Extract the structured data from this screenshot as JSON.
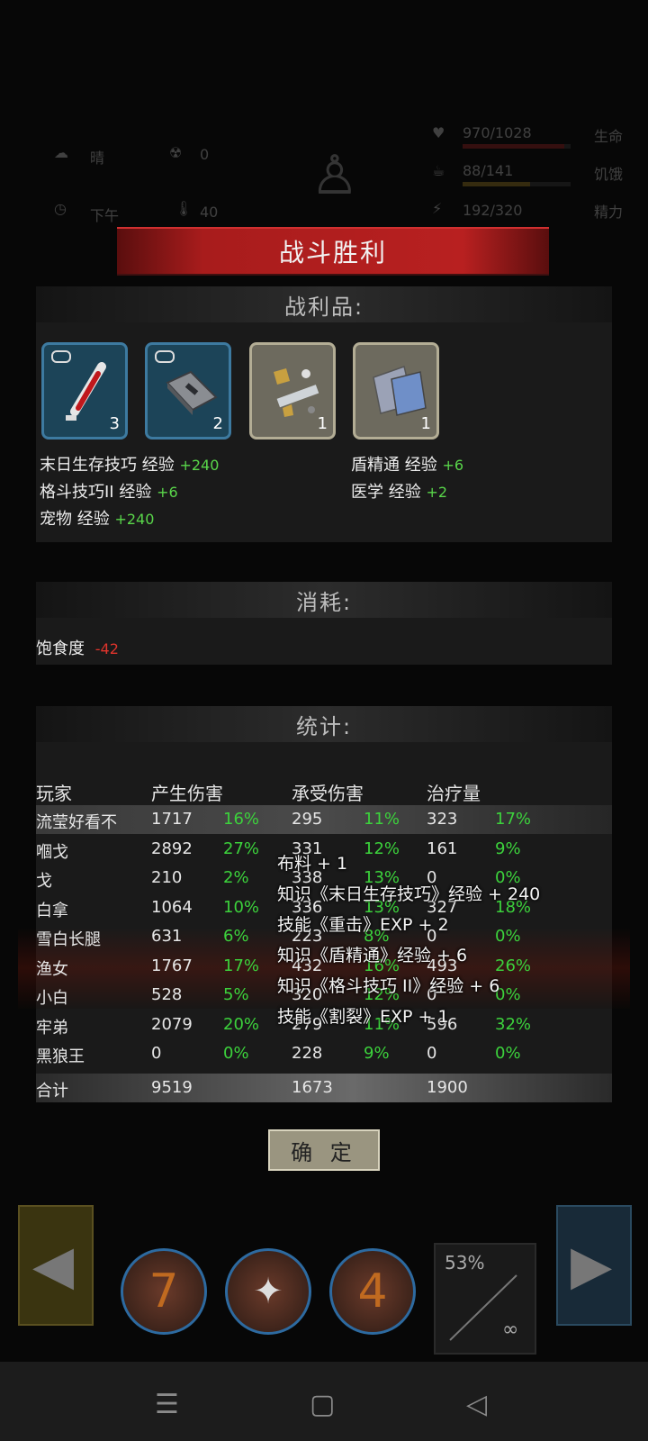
{
  "hud": {
    "weather": "晴",
    "radiation": "0",
    "time": "下午",
    "temperature": "40",
    "hp": "970/1028",
    "hp_label": "生命",
    "hunger": "88/141",
    "hunger_label": "饥饿",
    "energy": "192/320",
    "energy_label": "精力"
  },
  "title": "战斗胜利",
  "loot": {
    "heading": "战利品:",
    "items": [
      {
        "name": "syringe-icon",
        "count": "3"
      },
      {
        "name": "metal-plate-icon",
        "count": "2"
      },
      {
        "name": "scrap-parts-icon",
        "count": "1"
      },
      {
        "name": "cloth-icon",
        "count": "1"
      }
    ],
    "exp_left": [
      {
        "label": "末日生存技巧 经验",
        "gain": "+240"
      },
      {
        "label": "格斗技巧II 经验",
        "gain": "+6"
      },
      {
        "label": "宠物 经验",
        "gain": "+240"
      }
    ],
    "exp_right": [
      {
        "label": "盾精通 经验",
        "gain": "+6"
      },
      {
        "label": "医学 经验",
        "gain": "+2"
      }
    ]
  },
  "consume": {
    "heading": "消耗:",
    "label": "饱食度",
    "value": "-42"
  },
  "stats": {
    "heading": "统计:",
    "headers": [
      "玩家",
      "产生伤害",
      "承受伤害",
      "治疗量"
    ],
    "rows": [
      {
        "player": "流莹好看不",
        "dealt": "1717",
        "dealt_pct": "16%",
        "taken": "295",
        "taken_pct": "11%",
        "heal": "323",
        "heal_pct": "17%"
      },
      {
        "player": "嗰戈",
        "dealt": "2892",
        "dealt_pct": "27%",
        "taken": "331",
        "taken_pct": "12%",
        "heal": "161",
        "heal_pct": "9%"
      },
      {
        "player": "戈",
        "dealt": "210",
        "dealt_pct": "2%",
        "taken": "338",
        "taken_pct": "13%",
        "heal": "0",
        "heal_pct": "0%"
      },
      {
        "player": "白拿",
        "dealt": "1064",
        "dealt_pct": "10%",
        "taken": "336",
        "taken_pct": "13%",
        "heal": "327",
        "heal_pct": "18%"
      },
      {
        "player": "雪白长腿",
        "dealt": "631",
        "dealt_pct": "6%",
        "taken": "223",
        "taken_pct": "8%",
        "heal": "0",
        "heal_pct": "0%"
      },
      {
        "player": "渔女",
        "dealt": "1767",
        "dealt_pct": "17%",
        "taken": "432",
        "taken_pct": "16%",
        "heal": "493",
        "heal_pct": "26%"
      },
      {
        "player": "小白",
        "dealt": "528",
        "dealt_pct": "5%",
        "taken": "320",
        "taken_pct": "12%",
        "heal": "0",
        "heal_pct": "0%"
      },
      {
        "player": "牢弟",
        "dealt": "2079",
        "dealt_pct": "20%",
        "taken": "279",
        "taken_pct": "11%",
        "heal": "596",
        "heal_pct": "32%"
      },
      {
        "player": "黑狼王",
        "dealt": "0",
        "dealt_pct": "0%",
        "taken": "228",
        "taken_pct": "9%",
        "heal": "0",
        "heal_pct": "0%"
      }
    ],
    "total_label": "合计",
    "total_dealt": "9519",
    "total_taken": "1673",
    "total_heal": "1900"
  },
  "popup_lines": [
    "布料 + 1",
    "知识《末日生存技巧》经验 + 240",
    "技能《重击》EXP + 2",
    "知识《盾精通》经验 + 6",
    "知识《格斗技巧 II》经验 + 6",
    "技能《割裂》EXP + 1"
  ],
  "confirm_label": "确 定",
  "skills": {
    "skill1_count": "7",
    "skill3_count": "4",
    "progress": "53%",
    "infinity": "∞"
  },
  "colors": {
    "gain": "#59d64a",
    "loss": "#e0342c",
    "banner": "#b82020",
    "pct": "#3cd23c"
  }
}
